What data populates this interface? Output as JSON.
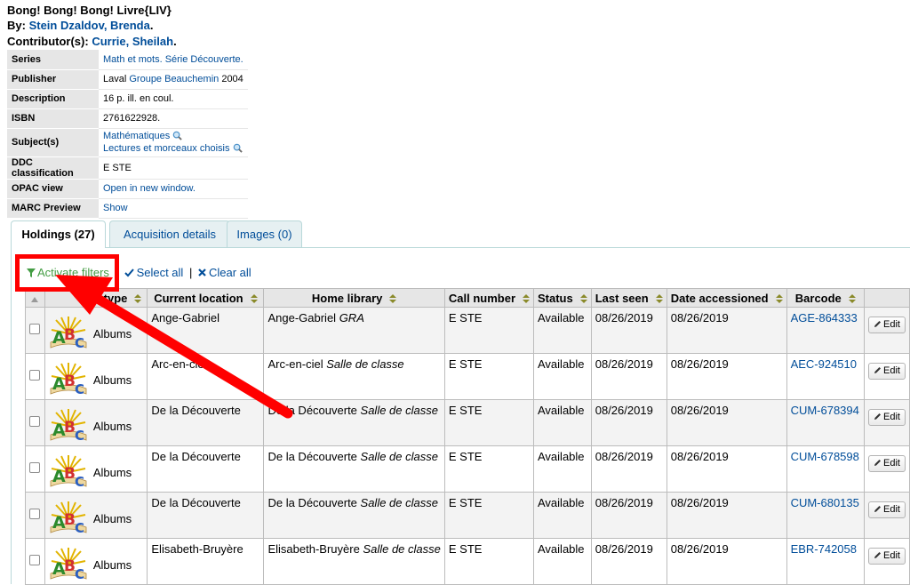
{
  "record": {
    "title": "Bong! Bong! Bong! Livre{LIV}",
    "by_label": "By: ",
    "author": "Stein Dzaldov, Brenda",
    "contrib_label": "Contributor(s): ",
    "contributor": "Currie, Sheilah",
    "period": "."
  },
  "biblio": {
    "series_label": "Series",
    "series_value": "Math et mots. Série Découverte.",
    "publisher_label": "Publisher",
    "publisher_place": "Laval ",
    "publisher_link": "Groupe Beauchemin",
    "publisher_year": " 2004",
    "description_label": "Description",
    "description_value": "16 p. ill. en coul.",
    "isbn_label": "ISBN",
    "isbn_value": "2761622928.",
    "subjects_label": "Subject(s)",
    "subject_1": "Mathématiques",
    "subject_2": "Lectures et morceaux choisis",
    "ddc_label": "DDC classification",
    "ddc_value": "E STE",
    "opac_label": "OPAC view",
    "opac_value": "Open in new window.",
    "marc_label": "MARC Preview",
    "marc_value": "Show"
  },
  "tabs": {
    "holdings": "Holdings (27)",
    "acquisition": "Acquisition details",
    "images": "Images (0)"
  },
  "toolbar": {
    "activate_filters": "Activate filters",
    "sep": "|",
    "select_all": "Select all",
    "clear_all": "Clear all"
  },
  "columns": {
    "type": "type",
    "location": "Current location",
    "home": "Home library",
    "call": "Call number",
    "status": "Status",
    "last_seen": "Last seen",
    "accessioned": "Date accessioned",
    "barcode": "Barcode"
  },
  "rows": [
    {
      "type": "Albums",
      "location": "Ange-Gabriel",
      "home": "Ange-Gabriel ",
      "home_loc": "GRA",
      "call": "E STE",
      "status": "Available",
      "last_seen": "08/26/2019",
      "accessioned": "08/26/2019",
      "barcode": "AGE-864333",
      "edit": "Edit"
    },
    {
      "type": "Albums",
      "location": "Arc-en-ciel",
      "home": "Arc-en-ciel ",
      "home_loc": "Salle de classe",
      "call": "E STE",
      "status": "Available",
      "last_seen": "08/26/2019",
      "accessioned": "08/26/2019",
      "barcode": "AEC-924510",
      "edit": "Edit"
    },
    {
      "type": "Albums",
      "location": "De la Découverte",
      "home": "De la Découverte ",
      "home_loc": "Salle de classe",
      "call": "E STE",
      "status": "Available",
      "last_seen": "08/26/2019",
      "accessioned": "08/26/2019",
      "barcode": "CUM-678394",
      "edit": "Edit"
    },
    {
      "type": "Albums",
      "location": "De la Découverte",
      "home": "De la Découverte ",
      "home_loc": "Salle de classe",
      "call": "E STE",
      "status": "Available",
      "last_seen": "08/26/2019",
      "accessioned": "08/26/2019",
      "barcode": "CUM-678598",
      "edit": "Edit"
    },
    {
      "type": "Albums",
      "location": "De la Découverte",
      "home": "De la Découverte ",
      "home_loc": "Salle de classe",
      "call": "E STE",
      "status": "Available",
      "last_seen": "08/26/2019",
      "accessioned": "08/26/2019",
      "barcode": "CUM-680135",
      "edit": "Edit"
    },
    {
      "type": "Albums",
      "location": "Elisabeth-Bruyère",
      "home": "Elisabeth-Bruyère ",
      "home_loc": "Salle de classe",
      "call": "E STE",
      "status": "Available",
      "last_seen": "08/26/2019",
      "accessioned": "08/26/2019",
      "barcode": "EBR-742058",
      "edit": "Edit"
    }
  ],
  "icons": {
    "search": "magnifier-icon",
    "filter": "filter-icon",
    "check": "check-icon",
    "clear": "x-icon",
    "sort": "sort-icon",
    "edit": "pencil-icon",
    "itemtype": "abc-albums-icon"
  },
  "colors": {
    "link": "#004d99",
    "filter_link": "#449d44",
    "annotation": "#ff0000",
    "header_bg": "#e6e6e6"
  }
}
